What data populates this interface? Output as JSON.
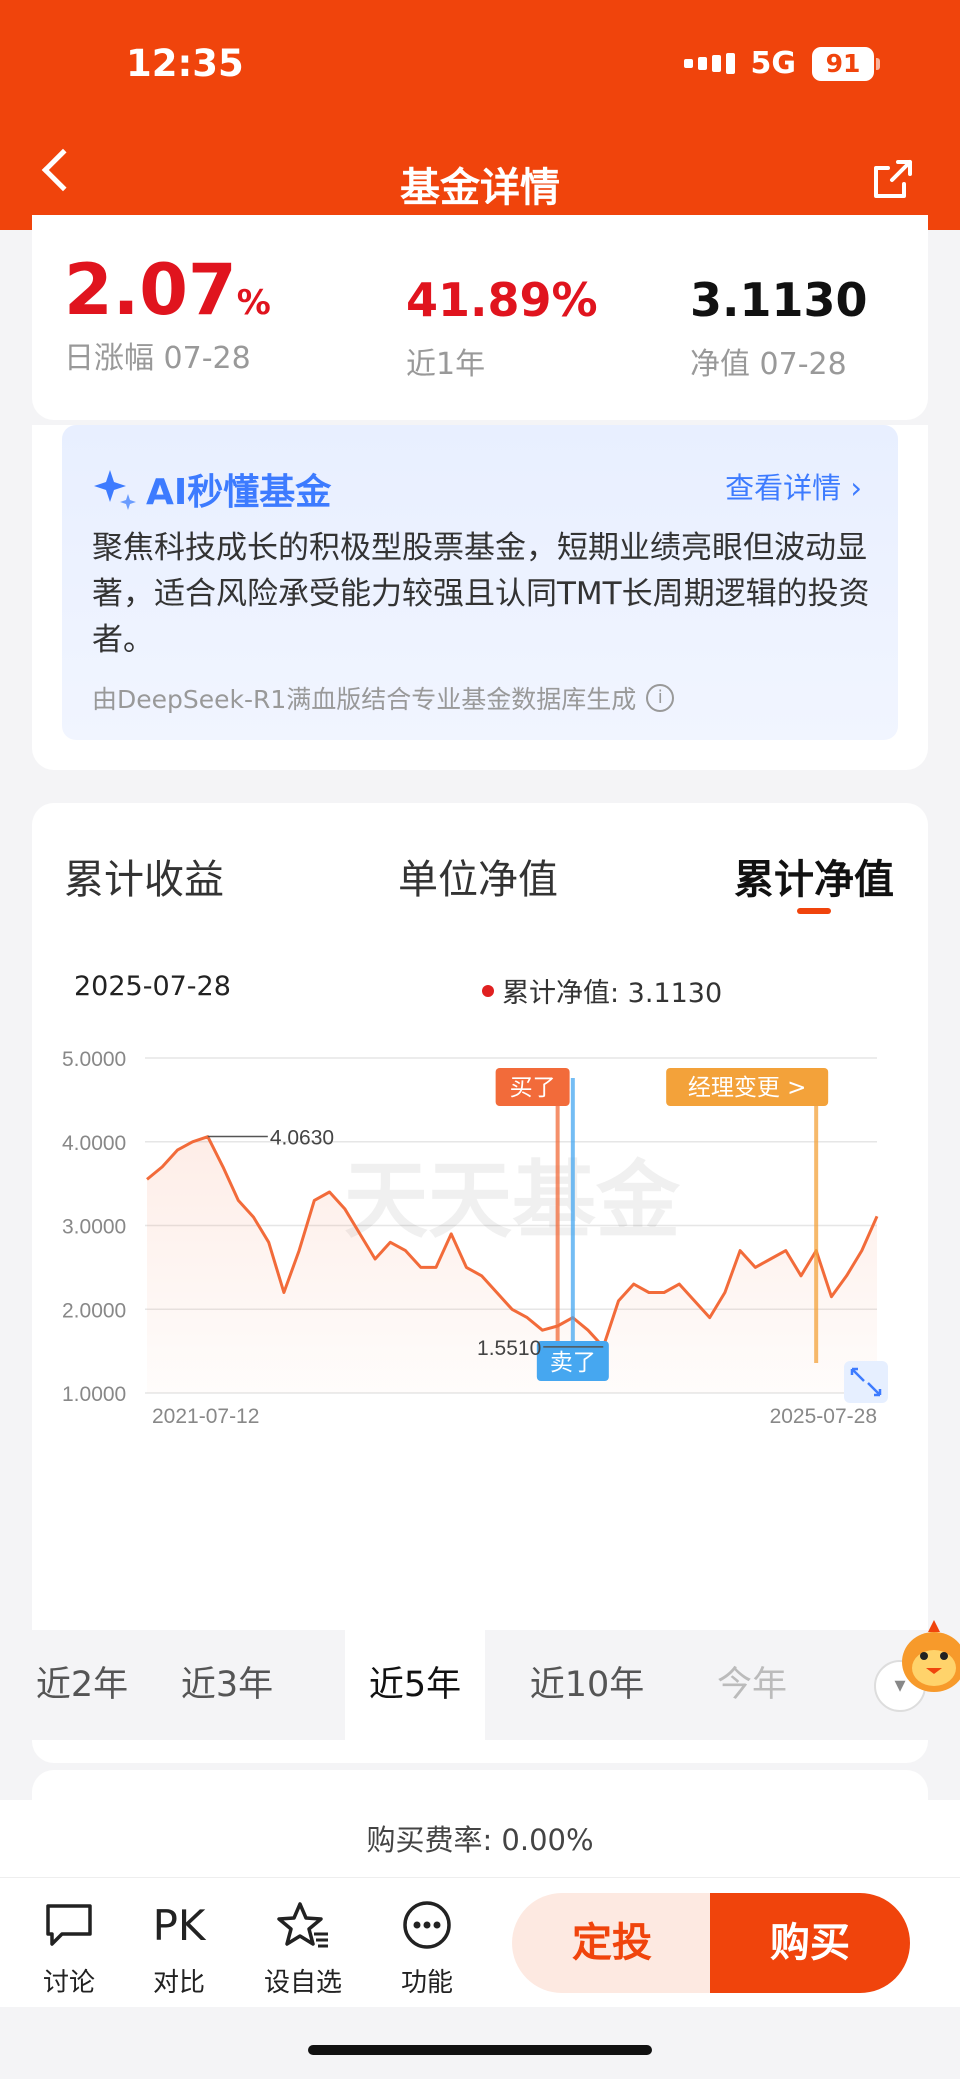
{
  "status": {
    "time": "12:35",
    "network": "5G",
    "battery": "91"
  },
  "nav": {
    "title": "基金详情"
  },
  "stats": [
    {
      "value": "2.07",
      "unit": "%",
      "label": "日涨幅 07-28",
      "color": "#e0141e"
    },
    {
      "value": "41.89%",
      "label": "近1年",
      "color": "#e0141e"
    },
    {
      "value": "3.1130",
      "label": "净值 07-28",
      "color": "#111111"
    }
  ],
  "ai": {
    "title": "AI秒懂基金",
    "link": "查看详情",
    "text": "聚焦科技成长的积极型股票基金，短期业绩亮眼但波动显著，适合风险承受能力较强且认同TMT长周期逻辑的投资者。",
    "source": "由DeepSeek-R1满血版结合专业基金数据库生成"
  },
  "tabs": [
    "累计收益",
    "单位净值",
    "累计净值"
  ],
  "chart_header": {
    "date": "2025-07-28",
    "legend": "累计净值: 3.1130"
  },
  "chart_data": {
    "type": "line",
    "title": "",
    "xlabel": "",
    "ylabel": "",
    "x_ticks": [
      "2021-07-12",
      "2025-07-28"
    ],
    "y_ticks": [
      "5.0000",
      "4.0000",
      "3.0000",
      "2.0000",
      "1.0000"
    ],
    "ylim": [
      1.0,
      5.0
    ],
    "watermark": "天天基金",
    "series": [
      {
        "color": "#f26b3a",
        "x": [
          "2021-07",
          "2021-08",
          "2021-09",
          "2021-10",
          "2021-11",
          "2021-12",
          "2022-01",
          "2022-02",
          "2022-03",
          "2022-04",
          "2022-05",
          "2022-06",
          "2022-07",
          "2022-08",
          "2022-09",
          "2022-10",
          "2022-11",
          "2022-12",
          "2023-01",
          "2023-02",
          "2023-03",
          "2023-04",
          "2023-05",
          "2023-06",
          "2023-07",
          "2023-08",
          "2023-09",
          "2023-10",
          "2023-11",
          "2023-12",
          "2024-01",
          "2024-02",
          "2024-03",
          "2024-04",
          "2024-05",
          "2024-06",
          "2024-07",
          "2024-08",
          "2024-09",
          "2024-10",
          "2024-11",
          "2024-12",
          "2025-01",
          "2025-02",
          "2025-03",
          "2025-04",
          "2025-05",
          "2025-06",
          "2025-07"
        ],
        "values": [
          3.55,
          3.7,
          3.9,
          4.0,
          4.06,
          3.7,
          3.3,
          3.1,
          2.8,
          2.2,
          2.7,
          3.3,
          3.4,
          3.2,
          2.9,
          2.6,
          2.8,
          2.7,
          2.5,
          2.5,
          2.9,
          2.5,
          2.4,
          2.2,
          2.0,
          1.9,
          1.75,
          1.8,
          1.9,
          1.75,
          1.55,
          2.1,
          2.3,
          2.2,
          2.2,
          2.3,
          2.1,
          1.9,
          2.2,
          2.7,
          2.5,
          2.6,
          2.7,
          2.4,
          2.7,
          2.15,
          2.4,
          2.7,
          3.11
        ]
      }
    ],
    "annotations": [
      {
        "label": "4.0630",
        "x": "2021-11",
        "y": 4.063
      },
      {
        "label": "1.5510",
        "x": "2024-01",
        "y": 1.551
      }
    ],
    "markers": [
      {
        "label": "买了",
        "x": "2023-10",
        "color": "#f26b3a"
      },
      {
        "label": "卖了",
        "x": "2023-11",
        "color": "#46a7f0"
      },
      {
        "label": "经理变更 >",
        "x": "2025-03",
        "color": "#f3a23a"
      }
    ]
  },
  "periods": [
    "近2年",
    "近3年",
    "近5年",
    "近10年",
    "今年"
  ],
  "fee": "购买费率: 0.00%",
  "bottom": {
    "items": [
      {
        "icon": "discuss",
        "label": "讨论"
      },
      {
        "icon": "PK",
        "label": "对比"
      },
      {
        "icon": "star",
        "label": "设自选"
      },
      {
        "icon": "more",
        "label": "功能"
      }
    ],
    "sip": "定投",
    "buy": "购买"
  }
}
